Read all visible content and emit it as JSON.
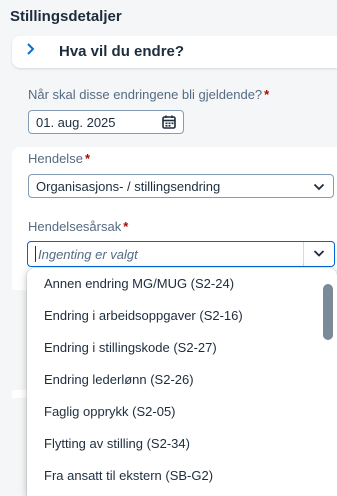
{
  "page": {
    "title": "Stillingsdetaljer"
  },
  "panel": {
    "title": "Hva vil du endre?",
    "icon": "chevron-right-icon"
  },
  "effective_date": {
    "label": "Når skal disse endringene bli gjeldende?",
    "required_marker": "*",
    "value": "01. aug. 2025",
    "icon": "calendar-icon"
  },
  "event": {
    "label": "Hendelse",
    "required_marker": "*",
    "value": "Organisasjons- / stillingsendring",
    "icon": "chevron-down-icon"
  },
  "event_reason": {
    "label": "Hendelsesårsak",
    "required_marker": "*",
    "placeholder": "Ingenting er valgt",
    "icon": "chevron-down-icon"
  },
  "dropdown": {
    "options": [
      "Annen endring MG/MUG (S2-24)",
      "Endring i arbeidsoppgaver (S2-16)",
      "Endring i stillingskode (S2-27)",
      "Endring lederlønn (S2-26)",
      "Faglig opprykk (S2-05)",
      "Flytting av stilling (S2-34)",
      "Fra ansatt til ekstern (SB-G2)"
    ]
  },
  "colors": {
    "accent": "#0064d9",
    "required": "#aa0808",
    "text": "#1d2d3e",
    "label": "#556b82"
  }
}
